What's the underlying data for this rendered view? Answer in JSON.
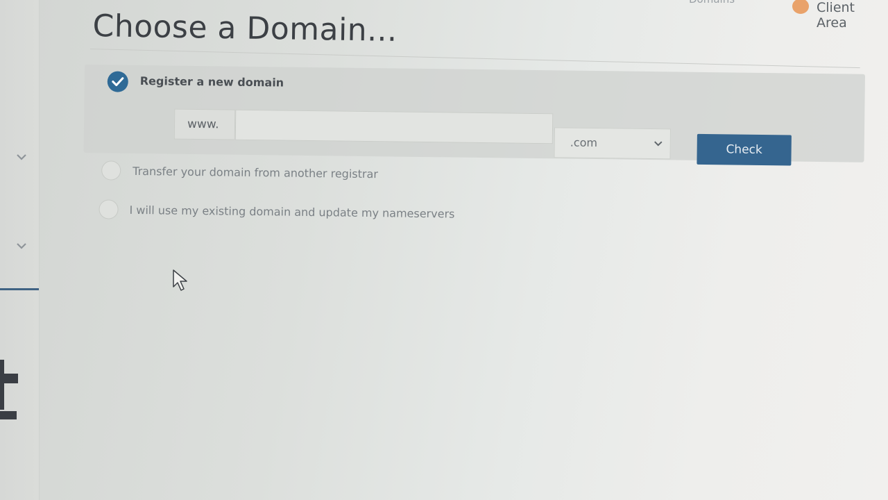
{
  "header": {
    "nav_domains": "Domains",
    "nav_client_area": "Client Area"
  },
  "page": {
    "title": "Choose a Domain..."
  },
  "options": {
    "register": {
      "label": "Register a new domain",
      "selected": true
    },
    "transfer": {
      "label": "Transfer your domain from another registrar",
      "selected": false
    },
    "existing": {
      "label": "I will use my existing domain and update my nameservers",
      "selected": false
    }
  },
  "domain_form": {
    "prefix": "www.",
    "input_value": "",
    "tld_selected": ".com",
    "check_label": "Check"
  },
  "colors": {
    "accent": "#35658f",
    "check_circle": "#2f6a96"
  }
}
